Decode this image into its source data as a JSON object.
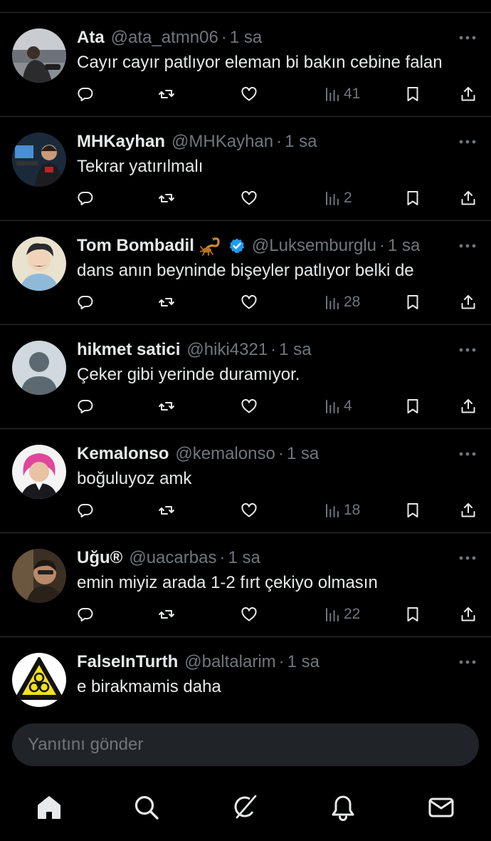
{
  "colors": {
    "background": "#000000",
    "text_primary": "#e7e9ea",
    "text_secondary": "#71767b",
    "divider": "#2f3336",
    "verified_blue": "#1d9bf0",
    "composer_bg": "#202327"
  },
  "tweets": [
    {
      "name": "Ata",
      "handle": "@ata_atmn06",
      "time": "1 sa",
      "text": "Cayır cayır patlıyor eleman bi bakın cebine falan",
      "views": "41",
      "verified": false,
      "emoji": ""
    },
    {
      "name": "MHKayhan",
      "handle": "@MHKayhan",
      "time": "1 sa",
      "text": "Tekrar yatırılmalı",
      "views": "2",
      "verified": false,
      "emoji": ""
    },
    {
      "name": "Tom Bombadil",
      "handle": "@Luksemburglu",
      "time": "1 sa",
      "text": "dans anın beyninde bişeyler patlıyor belki de",
      "views": "28",
      "verified": true,
      "emoji": "scorpion-emoji"
    },
    {
      "name": "hikmet satici",
      "handle": "@hiki4321",
      "time": "1 sa",
      "text": "Çeker gibi yerinde duramıyor.",
      "views": "4",
      "verified": false,
      "emoji": ""
    },
    {
      "name": "Kemalonso",
      "handle": "@kemalonso",
      "time": "1 sa",
      "text": "boğuluyoz amk",
      "views": "18",
      "verified": false,
      "emoji": ""
    },
    {
      "name": "Uğu®",
      "handle": "@uacarbas",
      "time": "1 sa",
      "text": "emin miyiz arada 1-2 fırt çekiyo olmasın",
      "views": "22",
      "verified": false,
      "emoji": ""
    },
    {
      "name": "FalseInTurth",
      "handle": "@baltalarim",
      "time": "1 sa",
      "text": "e birakmamis daha",
      "views": "",
      "verified": false,
      "emoji": ""
    }
  ],
  "composer": {
    "placeholder": "Yanıtını gönder"
  },
  "tabbar": {
    "icons": [
      "home-icon",
      "search-icon",
      "grok-icon",
      "notifications-bell-icon",
      "messages-envelope-icon"
    ],
    "active": "home-icon"
  }
}
